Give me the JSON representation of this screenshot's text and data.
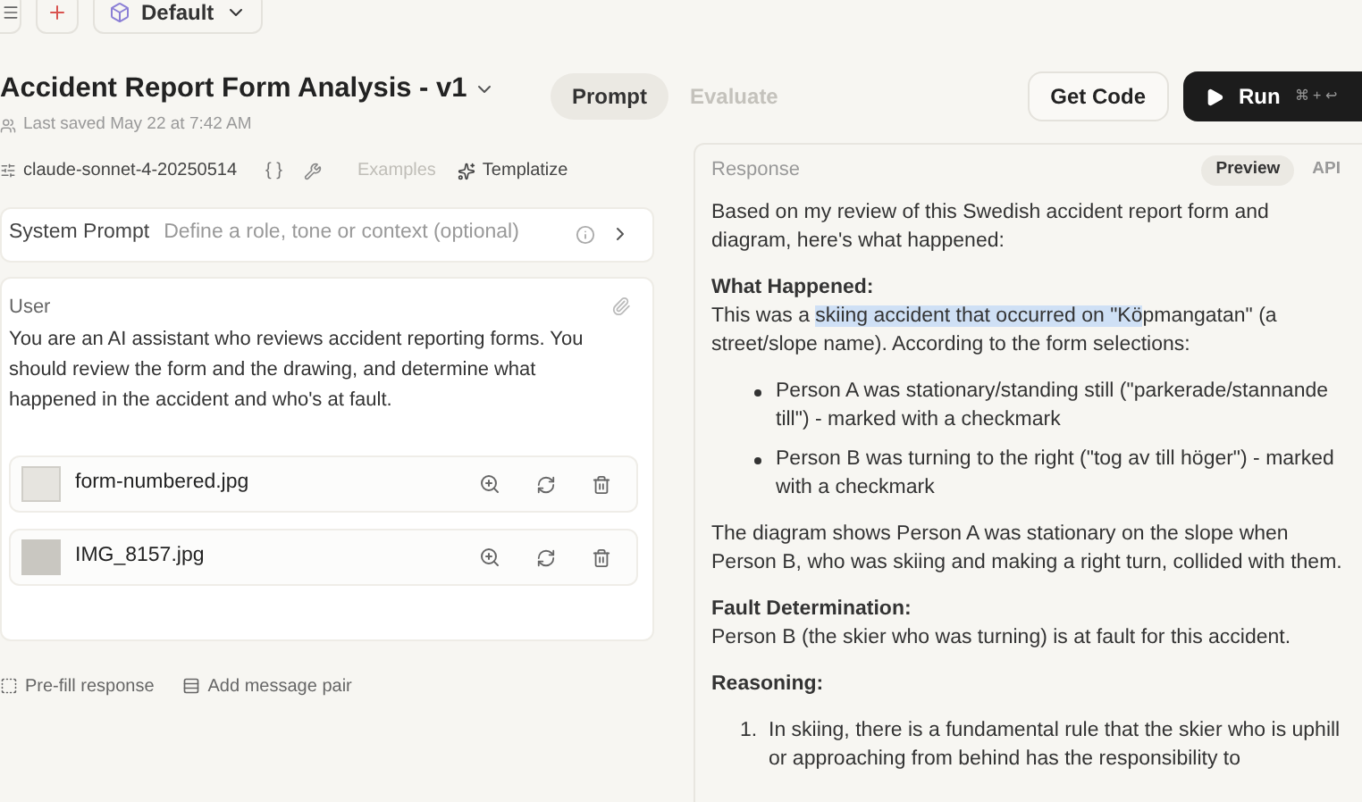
{
  "topbar": {
    "workspace": "Default"
  },
  "header": {
    "title": "Accident Report Form Analysis - v1",
    "saved": "Last saved May 22 at 7:42 AM"
  },
  "mode_tabs": [
    {
      "label": "Prompt",
      "selected": true
    },
    {
      "label": "Evaluate",
      "selected": false
    }
  ],
  "actions": {
    "get_code": "Get Code",
    "run": "Run",
    "run_shortcut": "⌘ + ↩"
  },
  "toolbar": {
    "model": "claude-sonnet-4-20250514",
    "braces": "{ }",
    "examples": "Examples",
    "templatize": "Templatize"
  },
  "system_prompt": {
    "label": "System Prompt",
    "placeholder": "Define a role, tone or context (optional)"
  },
  "user_message": {
    "label": "User",
    "text": "You are an AI assistant who reviews accident reporting forms. You should review the form and the drawing, and determine what happened in the accident and who's at fault.",
    "attachments": [
      {
        "name": "form-numbered.jpg",
        "kind": "form"
      },
      {
        "name": "IMG_8157.jpg",
        "kind": "sketch"
      }
    ]
  },
  "bottom_actions": {
    "prefill": "Pre-fill response",
    "add_pair": "Add message pair"
  },
  "response": {
    "label": "Response",
    "view_tabs": [
      {
        "label": "Preview",
        "selected": true
      },
      {
        "label": "API",
        "selected": false
      }
    ],
    "blocks": [
      {
        "kind": "paragraph",
        "text": "Based on my review of this Swedish accident report form and diagram, here's what happened:"
      },
      {
        "kind": "heading",
        "text": "What Happened:",
        "segments": [
          {
            "text": "This was a ",
            "highlighted": false
          },
          {
            "text": "skiing accident that occurred on \"Kö",
            "highlighted": true
          },
          {
            "text": "pmangatan\" (a street/slope name). According to the form selections:",
            "highlighted": false
          }
        ]
      },
      {
        "kind": "bullets",
        "items": [
          "Person A was stationary/standing still (\"parkerade/stannande till\") - marked with a checkmark",
          "Person B was turning to the right (\"tog av till höger\") - marked with a checkmark"
        ]
      },
      {
        "kind": "paragraph",
        "text": "The diagram shows Person A was stationary on the slope when Person B, who was skiing and making a right turn, collided with them."
      },
      {
        "kind": "heading",
        "text": "Fault Determination:",
        "segments": [
          {
            "text": "Person B (the skier who was turning) is at fault for this accident.",
            "highlighted": false
          }
        ]
      },
      {
        "kind": "heading",
        "text": "Reasoning:"
      },
      {
        "kind": "numbered",
        "items": [
          {
            "number": "1.",
            "text": "In skiing, there is a fundamental rule that the skier who is uphill or approaching from behind has the responsibility to"
          }
        ]
      }
    ]
  }
}
